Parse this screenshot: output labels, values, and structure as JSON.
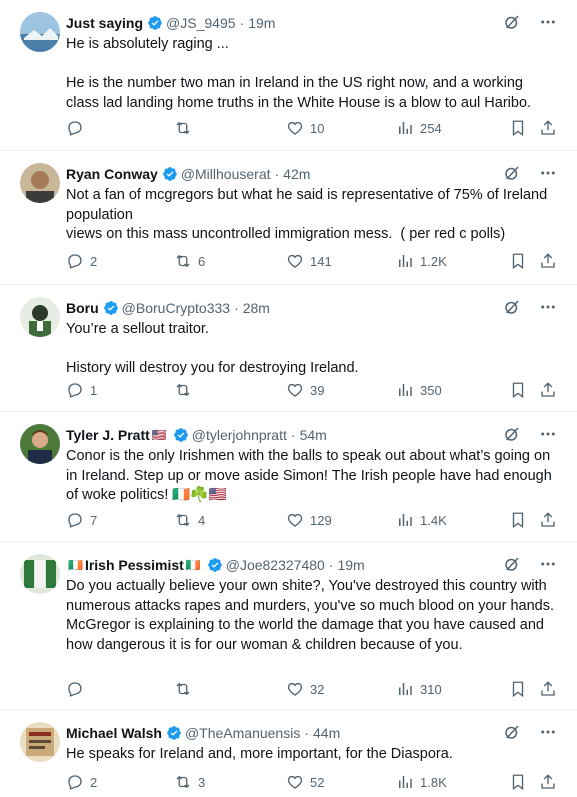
{
  "colors": {
    "verified": "#1d9bf0",
    "muted": "#536471",
    "text": "#0f1419",
    "divider": "#eff3f4"
  },
  "icons": [
    "verified-badge-icon",
    "grok-icon",
    "more-icon",
    "reply-icon",
    "retweet-icon",
    "like-icon",
    "views-icon",
    "bookmark-icon",
    "share-icon"
  ],
  "tweets": [
    {
      "name": "Just saying",
      "handle": "@JS_9495",
      "time": "19m",
      "text": "He is absolutely raging ...\n\nHe is the number two man in Ireland in the US right now, and a working class lad landing home truths in the White House is a blow to aul Haribo.",
      "replies": "",
      "retweets": "",
      "likes": "10",
      "views": "254"
    },
    {
      "name": "Ryan Conway",
      "handle": "@Millhouserat",
      "time": "42m",
      "text": "Not a fan of mcgregors but what he said is representative of 75% of Ireland population\nviews on this mass uncontrolled immigration mess.  ( per red c polls)",
      "replies": "2",
      "retweets": "6",
      "likes": "141",
      "views": "1.2K"
    },
    {
      "name": "Boru",
      "handle": "@BoruCrypto333",
      "time": "28m",
      "text": "You’re a sellout traitor.\n\nHistory will destroy you for destroying Ireland.",
      "replies": "1",
      "retweets": "",
      "likes": "39",
      "views": "350"
    },
    {
      "name": "Tyler J. Pratt",
      "name_suffix": "🇺🇸",
      "handle": "@tylerjohnpratt",
      "time": "54m",
      "text": "Conor is the only Irishmen with the balls to speak out about what’s going on in Ireland. Step up or move aside Simon! The Irish people have had enough of woke politics! 🇮🇪☘️🇺🇸",
      "replies": "7",
      "retweets": "4",
      "likes": "129",
      "views": "1.4K"
    },
    {
      "name": "Irish Pessimist",
      "name_prefix": "🇮🇪",
      "name_suffix": "🇮🇪",
      "handle": "@Joe82327480",
      "time": "19m",
      "text": "Do you actually believe your own shite?, You've destroyed this country with numerous attacks rapes and murders, you've so much blood on your hands.\nMcGregor is explaining to the world the damage that you have caused and how dangerous it is for our woman & children because of you.",
      "replies": "",
      "retweets": "",
      "likes": "32",
      "views": "310"
    },
    {
      "name": "Michael Walsh",
      "handle": "@TheAmanuensis",
      "time": "44m",
      "text": "He speaks for Ireland and, more important, for the Diaspora.",
      "replies": "2",
      "retweets": "3",
      "likes": "52",
      "views": "1.8K"
    }
  ]
}
